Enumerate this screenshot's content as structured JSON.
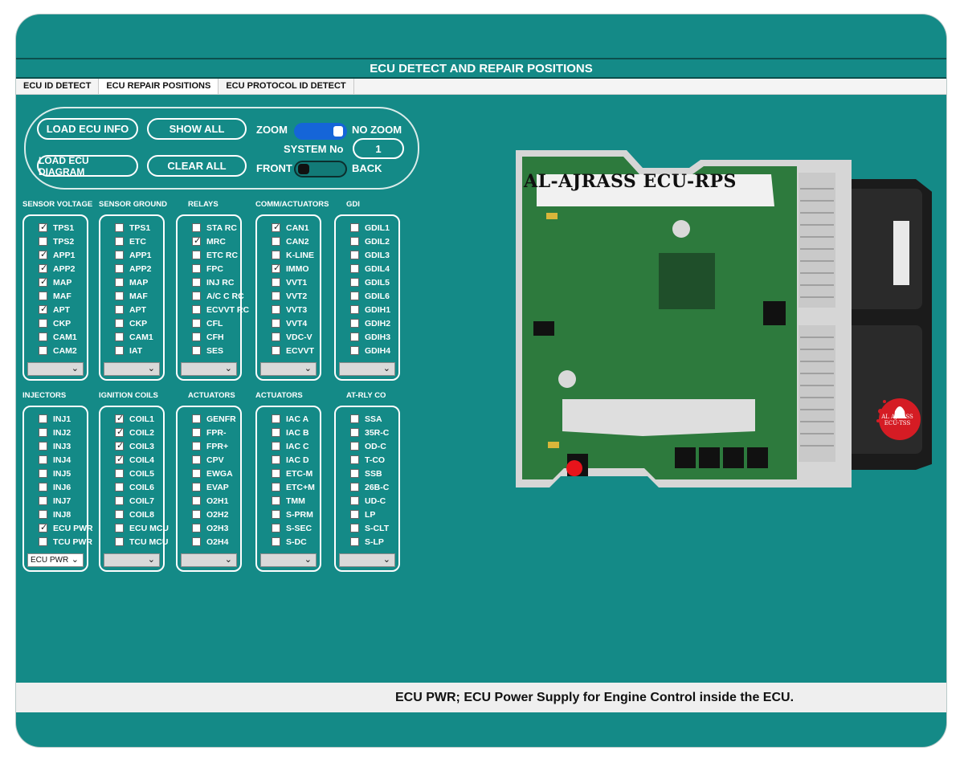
{
  "window": {
    "title": "ECU DETECT AND REPAIR POSITIONS"
  },
  "tabs": [
    {
      "label": "ECU ID DETECT"
    },
    {
      "label": "ECU REPAIR POSITIONS"
    },
    {
      "label": "ECU PROTOCOL ID DETECT"
    }
  ],
  "controls": {
    "load_ecu_info": "LOAD ECU INFO",
    "show_all": "SHOW ALL",
    "load_ecu_diagram": "LOAD ECU DIAGRAM",
    "clear_all": "CLEAR ALL",
    "zoom_label": "ZOOM",
    "no_zoom_label": "NO ZOOM",
    "zoom_on": true,
    "system_no_label": "SYSTEM No",
    "system_no_value": "1",
    "front_label": "FRONT",
    "back_label": "BACK",
    "front_back_on": false
  },
  "groups_row1": [
    {
      "title": "SENSOR VOLTAGE",
      "select": "",
      "items": [
        {
          "label": "TPS1",
          "checked": true
        },
        {
          "label": "TPS2",
          "checked": false
        },
        {
          "label": "APP1",
          "checked": true
        },
        {
          "label": "APP2",
          "checked": true
        },
        {
          "label": "MAP",
          "checked": true
        },
        {
          "label": "MAF",
          "checked": false
        },
        {
          "label": "APT",
          "checked": true
        },
        {
          "label": "CKP",
          "checked": false
        },
        {
          "label": "CAM1",
          "checked": false
        },
        {
          "label": "CAM2",
          "checked": false
        }
      ]
    },
    {
      "title": "SENSOR GROUND",
      "select": "",
      "items": [
        {
          "label": "TPS1",
          "checked": false
        },
        {
          "label": "ETC",
          "checked": false
        },
        {
          "label": "APP1",
          "checked": false
        },
        {
          "label": "APP2",
          "checked": false
        },
        {
          "label": "MAP",
          "checked": false
        },
        {
          "label": "MAF",
          "checked": false
        },
        {
          "label": "APT",
          "checked": false
        },
        {
          "label": "CKP",
          "checked": false
        },
        {
          "label": "CAM1",
          "checked": false
        },
        {
          "label": "IAT",
          "checked": false
        }
      ]
    },
    {
      "title": "RELAYS",
      "select": "",
      "items": [
        {
          "label": "STA RC",
          "checked": false
        },
        {
          "label": "MRC",
          "checked": true
        },
        {
          "label": "ETC RC",
          "checked": false
        },
        {
          "label": "FPC",
          "checked": false
        },
        {
          "label": "INJ RC",
          "checked": false
        },
        {
          "label": "A/C C RC",
          "checked": false
        },
        {
          "label": "ECVVT RC",
          "checked": false
        },
        {
          "label": "CFL",
          "checked": false
        },
        {
          "label": "CFH",
          "checked": false
        },
        {
          "label": "SES",
          "checked": false
        }
      ]
    },
    {
      "title": "COMM/ACTUATORS",
      "select": "",
      "items": [
        {
          "label": "CAN1",
          "checked": true
        },
        {
          "label": "CAN2",
          "checked": false
        },
        {
          "label": "K-LINE",
          "checked": false
        },
        {
          "label": "IMMO",
          "checked": true
        },
        {
          "label": "VVT1",
          "checked": false
        },
        {
          "label": "VVT2",
          "checked": false
        },
        {
          "label": "VVT3",
          "checked": false
        },
        {
          "label": "VVT4",
          "checked": false
        },
        {
          "label": "VDC-V",
          "checked": false
        },
        {
          "label": "ECVVT",
          "checked": false
        }
      ]
    },
    {
      "title": "GDI",
      "select": "",
      "items": [
        {
          "label": "GDIL1",
          "checked": false
        },
        {
          "label": "GDIL2",
          "checked": false
        },
        {
          "label": "GDIL3",
          "checked": false
        },
        {
          "label": "GDIL4",
          "checked": false
        },
        {
          "label": "GDIL5",
          "checked": false
        },
        {
          "label": "GDIL6",
          "checked": false
        },
        {
          "label": "GDIH1",
          "checked": false
        },
        {
          "label": "GDIH2",
          "checked": false
        },
        {
          "label": "GDIH3",
          "checked": false
        },
        {
          "label": "GDIH4",
          "checked": false
        }
      ]
    }
  ],
  "groups_row2": [
    {
      "title": "INJECTORS",
      "select": "ECU PWR",
      "items": [
        {
          "label": "INJ1",
          "checked": false
        },
        {
          "label": "INJ2",
          "checked": false
        },
        {
          "label": "INJ3",
          "checked": false
        },
        {
          "label": "INJ4",
          "checked": false
        },
        {
          "label": "INJ5",
          "checked": false
        },
        {
          "label": "INJ6",
          "checked": false
        },
        {
          "label": "INJ7",
          "checked": false
        },
        {
          "label": "INJ8",
          "checked": false
        },
        {
          "label": "ECU PWR",
          "checked": true
        },
        {
          "label": "TCU PWR",
          "checked": false
        }
      ]
    },
    {
      "title": "IGNITION COILS",
      "select": "",
      "items": [
        {
          "label": "COIL1",
          "checked": true
        },
        {
          "label": "COIL2",
          "checked": true
        },
        {
          "label": "COIL3",
          "checked": true
        },
        {
          "label": "COIL4",
          "checked": true
        },
        {
          "label": "COIL5",
          "checked": false
        },
        {
          "label": "COIL6",
          "checked": false
        },
        {
          "label": "COIL7",
          "checked": false
        },
        {
          "label": "COIL8",
          "checked": false
        },
        {
          "label": "ECU MCU",
          "checked": false
        },
        {
          "label": "TCU MCU",
          "checked": false
        }
      ]
    },
    {
      "title": "ACTUATORS",
      "select": "",
      "items": [
        {
          "label": "GENFR",
          "checked": false
        },
        {
          "label": "FPR-",
          "checked": false
        },
        {
          "label": "FPR+",
          "checked": false
        },
        {
          "label": "CPV",
          "checked": false
        },
        {
          "label": "EWGA",
          "checked": false
        },
        {
          "label": "EVAP",
          "checked": false
        },
        {
          "label": "O2H1",
          "checked": false
        },
        {
          "label": "O2H2",
          "checked": false
        },
        {
          "label": "O2H3",
          "checked": false
        },
        {
          "label": "O2H4",
          "checked": false
        }
      ]
    },
    {
      "title": "ACTUATORS",
      "select": "",
      "items": [
        {
          "label": "IAC A",
          "checked": false
        },
        {
          "label": "IAC B",
          "checked": false
        },
        {
          "label": "IAC C",
          "checked": false
        },
        {
          "label": "IAC D",
          "checked": false
        },
        {
          "label": "ETC-M",
          "checked": false
        },
        {
          "label": "ETC+M",
          "checked": false
        },
        {
          "label": "TMM",
          "checked": false
        },
        {
          "label": "S-PRM",
          "checked": false
        },
        {
          "label": "S-SEC",
          "checked": false
        },
        {
          "label": "S-DC",
          "checked": false
        }
      ]
    },
    {
      "title": "AT-RLY CO",
      "select": "",
      "items": [
        {
          "label": "SSA",
          "checked": false
        },
        {
          "label": "35R-C",
          "checked": false
        },
        {
          "label": "OD-C",
          "checked": false
        },
        {
          "label": "T-CO",
          "checked": false
        },
        {
          "label": "SSB",
          "checked": false
        },
        {
          "label": "26B-C",
          "checked": false
        },
        {
          "label": "UD-C",
          "checked": false
        },
        {
          "label": "LP",
          "checked": false
        },
        {
          "label": "S-CLT",
          "checked": false
        },
        {
          "label": "S-LP",
          "checked": false
        }
      ]
    }
  ],
  "diagram": {
    "title": "AL-AJRASS ECU-RPS",
    "logo_line1": "AL AJRASS",
    "logo_line2": "ECU-TSS",
    "marker_color": "#e8141b",
    "board_color": "#2d7a3d"
  },
  "status": {
    "text": "ECU PWR; ECU Power Supply for Engine Control inside the ECU."
  },
  "colors": {
    "background": "#148a87",
    "accent": "#1565d8",
    "panel_border": "#ffffff"
  }
}
